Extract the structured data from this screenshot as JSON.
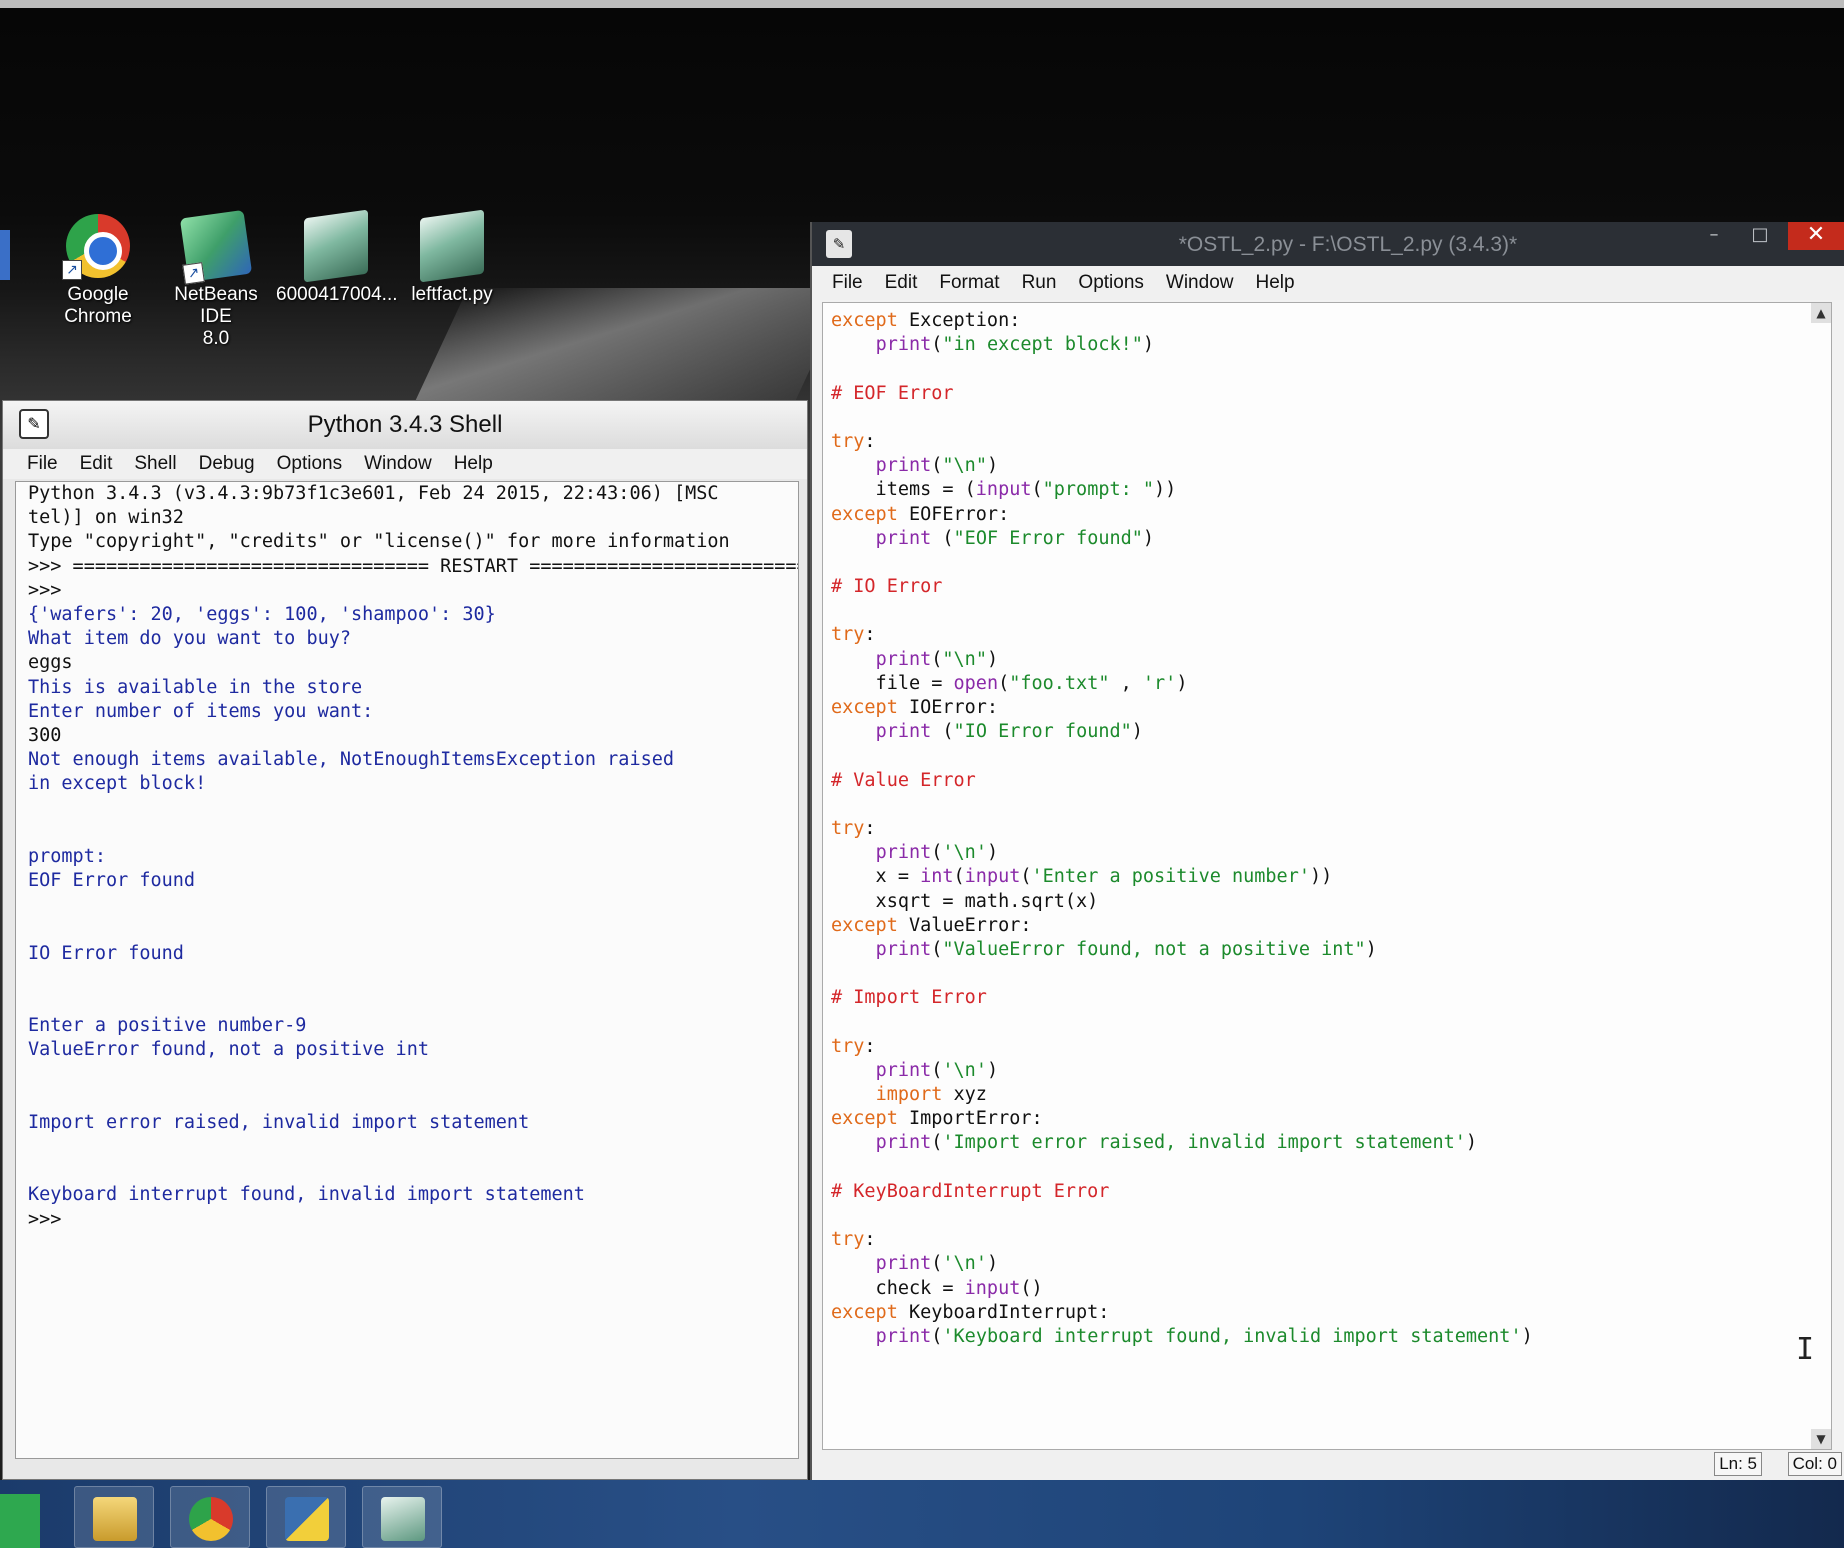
{
  "desktop": {
    "icons": [
      {
        "label_line1": "Google",
        "label_line2": "Chrome",
        "icon": "chrome-icon"
      },
      {
        "label_line1": "NetBeans IDE",
        "label_line2": "8.0",
        "icon": "netbeans-icon"
      },
      {
        "label_line1": "6000417004...",
        "label_line2": "",
        "icon": "python-file-icon"
      },
      {
        "label_line1": "leftfact.py",
        "label_line2": "",
        "icon": "python-file-icon"
      }
    ]
  },
  "shell": {
    "title": "Python 3.4.3 Shell",
    "menu": [
      "File",
      "Edit",
      "Shell",
      "Debug",
      "Options",
      "Window",
      "Help"
    ],
    "lines": [
      {
        "text": "Python 3.4.3 (v3.4.3:9b73f1c3e601, Feb 24 2015, 22:43:06) [MSC",
        "color": "black"
      },
      {
        "text": "tel)] on win32",
        "color": "black"
      },
      {
        "text": "Type \"copyright\", \"credits\" or \"license()\" for more information",
        "color": "black"
      },
      {
        "text": ">>> ================================ RESTART ================================",
        "color": "black"
      },
      {
        "text": ">>>",
        "color": "black"
      },
      {
        "text": "{'wafers': 20, 'eggs': 100, 'shampoo': 30}",
        "color": "blue"
      },
      {
        "text": "What item do you want to buy?",
        "color": "blue"
      },
      {
        "text": "eggs",
        "color": "black"
      },
      {
        "text": "This is available in the store",
        "color": "blue"
      },
      {
        "text": "Enter number of items you want:",
        "color": "blue"
      },
      {
        "text": "300",
        "color": "black"
      },
      {
        "text": "Not enough items available, NotEnoughItemsException raised",
        "color": "blue"
      },
      {
        "text": "in except block!",
        "color": "blue"
      },
      {
        "text": "",
        "color": "blue"
      },
      {
        "text": "",
        "color": "blue"
      },
      {
        "text": "prompt:",
        "color": "blue"
      },
      {
        "text": "EOF Error found",
        "color": "blue"
      },
      {
        "text": "",
        "color": "blue"
      },
      {
        "text": "",
        "color": "blue"
      },
      {
        "text": "IO Error found",
        "color": "blue"
      },
      {
        "text": "",
        "color": "blue"
      },
      {
        "text": "",
        "color": "blue"
      },
      {
        "text": "Enter a positive number-9",
        "color": "blue"
      },
      {
        "text": "ValueError found, not a positive int",
        "color": "blue"
      },
      {
        "text": "",
        "color": "blue"
      },
      {
        "text": "",
        "color": "blue"
      },
      {
        "text": "Import error raised, invalid import statement",
        "color": "blue"
      },
      {
        "text": "",
        "color": "blue"
      },
      {
        "text": "",
        "color": "blue"
      },
      {
        "text": "Keyboard interrupt found, invalid import statement",
        "color": "blue"
      },
      {
        "text": ">>>",
        "color": "black"
      }
    ]
  },
  "editor": {
    "title": "*OSTL_2.py - F:\\OSTL_2.py (3.4.3)*",
    "menu": [
      "File",
      "Edit",
      "Format",
      "Run",
      "Options",
      "Window",
      "Help"
    ],
    "lines": [
      [
        {
          "t": "except",
          "c": "kw"
        },
        {
          "t": " Exception:",
          "c": "df"
        }
      ],
      [
        {
          "t": "    ",
          "c": "df"
        },
        {
          "t": "print",
          "c": "bi"
        },
        {
          "t": "(",
          "c": "df"
        },
        {
          "t": "\"in except block!\"",
          "c": "st"
        },
        {
          "t": ")",
          "c": "df"
        }
      ],
      [],
      [
        {
          "t": "# EOF Error",
          "c": "cm"
        }
      ],
      [],
      [
        {
          "t": "try",
          "c": "kw"
        },
        {
          "t": ":",
          "c": "df"
        }
      ],
      [
        {
          "t": "    ",
          "c": "df"
        },
        {
          "t": "print",
          "c": "bi"
        },
        {
          "t": "(",
          "c": "df"
        },
        {
          "t": "\"\\n\"",
          "c": "st"
        },
        {
          "t": ")",
          "c": "df"
        }
      ],
      [
        {
          "t": "    items = (",
          "c": "df"
        },
        {
          "t": "input",
          "c": "bi"
        },
        {
          "t": "(",
          "c": "df"
        },
        {
          "t": "\"prompt: \"",
          "c": "st"
        },
        {
          "t": "))",
          "c": "df"
        }
      ],
      [
        {
          "t": "except",
          "c": "kw"
        },
        {
          "t": " EOFError:",
          "c": "df"
        }
      ],
      [
        {
          "t": "    ",
          "c": "df"
        },
        {
          "t": "print",
          "c": "bi"
        },
        {
          "t": " (",
          "c": "df"
        },
        {
          "t": "\"EOF Error found\"",
          "c": "st"
        },
        {
          "t": ")",
          "c": "df"
        }
      ],
      [],
      [
        {
          "t": "# IO Error",
          "c": "cm"
        }
      ],
      [],
      [
        {
          "t": "try",
          "c": "kw"
        },
        {
          "t": ":",
          "c": "df"
        }
      ],
      [
        {
          "t": "    ",
          "c": "df"
        },
        {
          "t": "print",
          "c": "bi"
        },
        {
          "t": "(",
          "c": "df"
        },
        {
          "t": "\"\\n\"",
          "c": "st"
        },
        {
          "t": ")",
          "c": "df"
        }
      ],
      [
        {
          "t": "    file = ",
          "c": "df"
        },
        {
          "t": "open",
          "c": "bi"
        },
        {
          "t": "(",
          "c": "df"
        },
        {
          "t": "\"foo.txt\"",
          "c": "st"
        },
        {
          "t": " , ",
          "c": "df"
        },
        {
          "t": "'r'",
          "c": "st"
        },
        {
          "t": ")",
          "c": "df"
        }
      ],
      [
        {
          "t": "except",
          "c": "kw"
        },
        {
          "t": " IOError:",
          "c": "df"
        }
      ],
      [
        {
          "t": "    ",
          "c": "df"
        },
        {
          "t": "print",
          "c": "bi"
        },
        {
          "t": " (",
          "c": "df"
        },
        {
          "t": "\"IO Error found\"",
          "c": "st"
        },
        {
          "t": ")",
          "c": "df"
        }
      ],
      [],
      [
        {
          "t": "# Value Error",
          "c": "cm"
        }
      ],
      [],
      [
        {
          "t": "try",
          "c": "kw"
        },
        {
          "t": ":",
          "c": "df"
        }
      ],
      [
        {
          "t": "    ",
          "c": "df"
        },
        {
          "t": "print",
          "c": "bi"
        },
        {
          "t": "(",
          "c": "df"
        },
        {
          "t": "'\\n'",
          "c": "st"
        },
        {
          "t": ")",
          "c": "df"
        }
      ],
      [
        {
          "t": "    x = ",
          "c": "df"
        },
        {
          "t": "int",
          "c": "bi"
        },
        {
          "t": "(",
          "c": "df"
        },
        {
          "t": "input",
          "c": "bi"
        },
        {
          "t": "(",
          "c": "df"
        },
        {
          "t": "'Enter a positive number'",
          "c": "st"
        },
        {
          "t": "))",
          "c": "df"
        }
      ],
      [
        {
          "t": "    xsqrt = math.sqrt(x)",
          "c": "df"
        }
      ],
      [
        {
          "t": "except",
          "c": "kw"
        },
        {
          "t": " ValueError:",
          "c": "df"
        }
      ],
      [
        {
          "t": "    ",
          "c": "df"
        },
        {
          "t": "print",
          "c": "bi"
        },
        {
          "t": "(",
          "c": "df"
        },
        {
          "t": "\"ValueError found, not a positive int\"",
          "c": "st"
        },
        {
          "t": ")",
          "c": "df"
        }
      ],
      [],
      [
        {
          "t": "# Import Error",
          "c": "cm"
        }
      ],
      [],
      [
        {
          "t": "try",
          "c": "kw"
        },
        {
          "t": ":",
          "c": "df"
        }
      ],
      [
        {
          "t": "    ",
          "c": "df"
        },
        {
          "t": "print",
          "c": "bi"
        },
        {
          "t": "(",
          "c": "df"
        },
        {
          "t": "'\\n'",
          "c": "st"
        },
        {
          "t": ")",
          "c": "df"
        }
      ],
      [
        {
          "t": "    ",
          "c": "df"
        },
        {
          "t": "import",
          "c": "kw"
        },
        {
          "t": " xyz",
          "c": "df"
        }
      ],
      [
        {
          "t": "except",
          "c": "kw"
        },
        {
          "t": " ImportError:",
          "c": "df"
        }
      ],
      [
        {
          "t": "    ",
          "c": "df"
        },
        {
          "t": "print",
          "c": "bi"
        },
        {
          "t": "(",
          "c": "df"
        },
        {
          "t": "'Import error raised, invalid import statement'",
          "c": "st"
        },
        {
          "t": ")",
          "c": "df"
        }
      ],
      [],
      [
        {
          "t": "# KeyBoardInterrupt Error",
          "c": "cm"
        }
      ],
      [],
      [
        {
          "t": "try",
          "c": "kw"
        },
        {
          "t": ":",
          "c": "df"
        }
      ],
      [
        {
          "t": "    ",
          "c": "df"
        },
        {
          "t": "print",
          "c": "bi"
        },
        {
          "t": "(",
          "c": "df"
        },
        {
          "t": "'\\n'",
          "c": "st"
        },
        {
          "t": ")",
          "c": "df"
        }
      ],
      [
        {
          "t": "    check = ",
          "c": "df"
        },
        {
          "t": "input",
          "c": "bi"
        },
        {
          "t": "()",
          "c": "df"
        }
      ],
      [
        {
          "t": "except",
          "c": "kw"
        },
        {
          "t": " KeyboardInterrupt:",
          "c": "df"
        }
      ],
      [
        {
          "t": "    ",
          "c": "df"
        },
        {
          "t": "print",
          "c": "bi"
        },
        {
          "t": "(",
          "c": "df"
        },
        {
          "t": "'Keyboard interrupt found, invalid import statement'",
          "c": "st"
        },
        {
          "t": ")",
          "c": "df"
        }
      ]
    ],
    "status": {
      "line": "Ln: 5",
      "col": "Col: 0"
    }
  },
  "taskbar": {
    "items": [
      "start-icon",
      "file-explorer-icon",
      "chrome-icon",
      "python-idle-icon",
      "python-file-icon"
    ]
  },
  "colors": {
    "keyword": "#e06a1a",
    "comment": "#d4262a",
    "string": "#1c8a2c",
    "builtin": "#8a2aa8",
    "shell_output": "#1e2aa0",
    "close_button": "#c42b1c"
  }
}
